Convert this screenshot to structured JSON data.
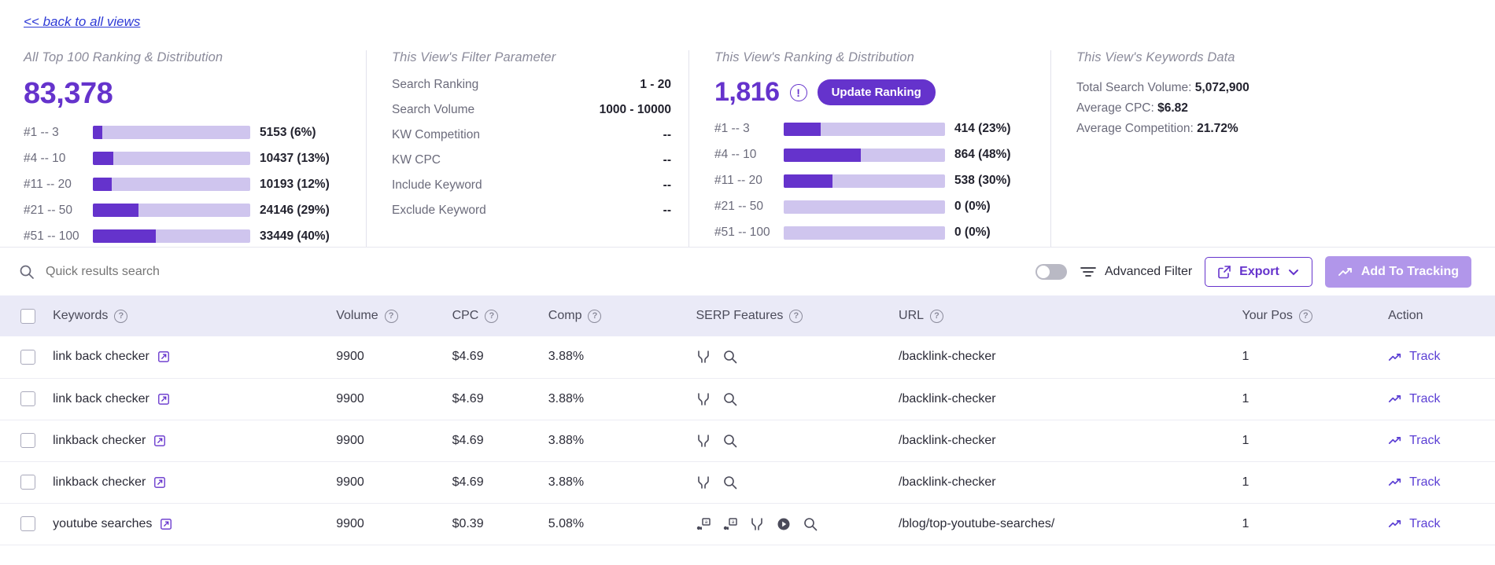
{
  "back_link": "<< back to all views",
  "panels": {
    "all_ranking": {
      "title": "All Top 100 Ranking & Distribution",
      "total": "83,378",
      "rows": [
        {
          "label": "#1 -- 3",
          "value": "5153 (6%)",
          "pct": 6
        },
        {
          "label": "#4 -- 10",
          "value": "10437 (13%)",
          "pct": 13
        },
        {
          "label": "#11 -- 20",
          "value": "10193 (12%)",
          "pct": 12
        },
        {
          "label": "#21 -- 50",
          "value": "24146 (29%)",
          "pct": 29
        },
        {
          "label": "#51 -- 100",
          "value": "33449 (40%)",
          "pct": 40
        }
      ]
    },
    "filter": {
      "title": "This View's Filter Parameter",
      "rows": [
        {
          "key": "Search Ranking",
          "value": "1 - 20"
        },
        {
          "key": "Search Volume",
          "value": "1000 - 10000"
        },
        {
          "key": "KW Competition",
          "value": "--"
        },
        {
          "key": "KW CPC",
          "value": "--"
        },
        {
          "key": "Include Keyword",
          "value": "--"
        },
        {
          "key": "Exclude Keyword",
          "value": "--"
        }
      ]
    },
    "view_ranking": {
      "title": "This View's Ranking & Distribution",
      "total": "1,816",
      "update_button": "Update Ranking",
      "rows": [
        {
          "label": "#1 -- 3",
          "value": "414 (23%)",
          "pct": 23
        },
        {
          "label": "#4 -- 10",
          "value": "864 (48%)",
          "pct": 48
        },
        {
          "label": "#11 -- 20",
          "value": "538 (30%)",
          "pct": 30
        },
        {
          "label": "#21 -- 50",
          "value": "0 (0%)",
          "pct": 0
        },
        {
          "label": "#51 -- 100",
          "value": "0 (0%)",
          "pct": 0
        }
      ]
    },
    "keywords_data": {
      "title": "This View's Keywords Data",
      "total_search_volume_label": "Total Search Volume:",
      "total_search_volume": "5,072,900",
      "average_cpc_label": "Average CPC:",
      "average_cpc": "$6.82",
      "average_competition_label": "Average Competition:",
      "average_competition": "21.72%"
    }
  },
  "toolbar": {
    "search_placeholder": "Quick results search",
    "search_value": "",
    "advanced_filter_label": "Advanced Filter",
    "export_label": "Export",
    "add_to_tracking_label": "Add To Tracking",
    "toggle_on": false
  },
  "table": {
    "headers": [
      {
        "label": "Keywords",
        "help": true
      },
      {
        "label": "Volume",
        "help": true
      },
      {
        "label": "CPC",
        "help": true
      },
      {
        "label": "Comp",
        "help": true
      },
      {
        "label": "SERP Features",
        "help": true
      },
      {
        "label": "URL",
        "help": true
      },
      {
        "label": "Your Pos",
        "help": true
      },
      {
        "label": "Action",
        "help": false
      }
    ],
    "rows": [
      {
        "keyword": "link back checker",
        "volume": "9900",
        "cpc": "$4.69",
        "comp": "3.88%",
        "serp": [
          "sitelinks-icon",
          "search-icon"
        ],
        "url": "/backlink-checker",
        "pos": "1",
        "action": "Track"
      },
      {
        "keyword": "link back checker",
        "volume": "9900",
        "cpc": "$4.69",
        "comp": "3.88%",
        "serp": [
          "sitelinks-icon",
          "search-icon"
        ],
        "url": "/backlink-checker",
        "pos": "1",
        "action": "Track"
      },
      {
        "keyword": "linkback checker",
        "volume": "9900",
        "cpc": "$4.69",
        "comp": "3.88%",
        "serp": [
          "sitelinks-icon",
          "search-icon"
        ],
        "url": "/backlink-checker",
        "pos": "1",
        "action": "Track"
      },
      {
        "keyword": "linkback checker",
        "volume": "9900",
        "cpc": "$4.69",
        "comp": "3.88%",
        "serp": [
          "sitelinks-icon",
          "search-icon"
        ],
        "url": "/backlink-checker",
        "pos": "1",
        "action": "Track"
      },
      {
        "keyword": "youtube searches",
        "volume": "9900",
        "cpc": "$0.39",
        "comp": "5.08%",
        "serp": [
          "ad-icon",
          "ad-icon",
          "sitelinks-icon",
          "video-icon",
          "search-icon"
        ],
        "url": "/blog/top-youtube-searches/",
        "pos": "1",
        "action": "Track"
      }
    ]
  },
  "colors": {
    "accent": "#6533cc",
    "accent_light": "#cfc5ee",
    "link": "#2f3bd6",
    "header_bg": "#eaeaf7",
    "tracking_btn": "#b196ea"
  }
}
